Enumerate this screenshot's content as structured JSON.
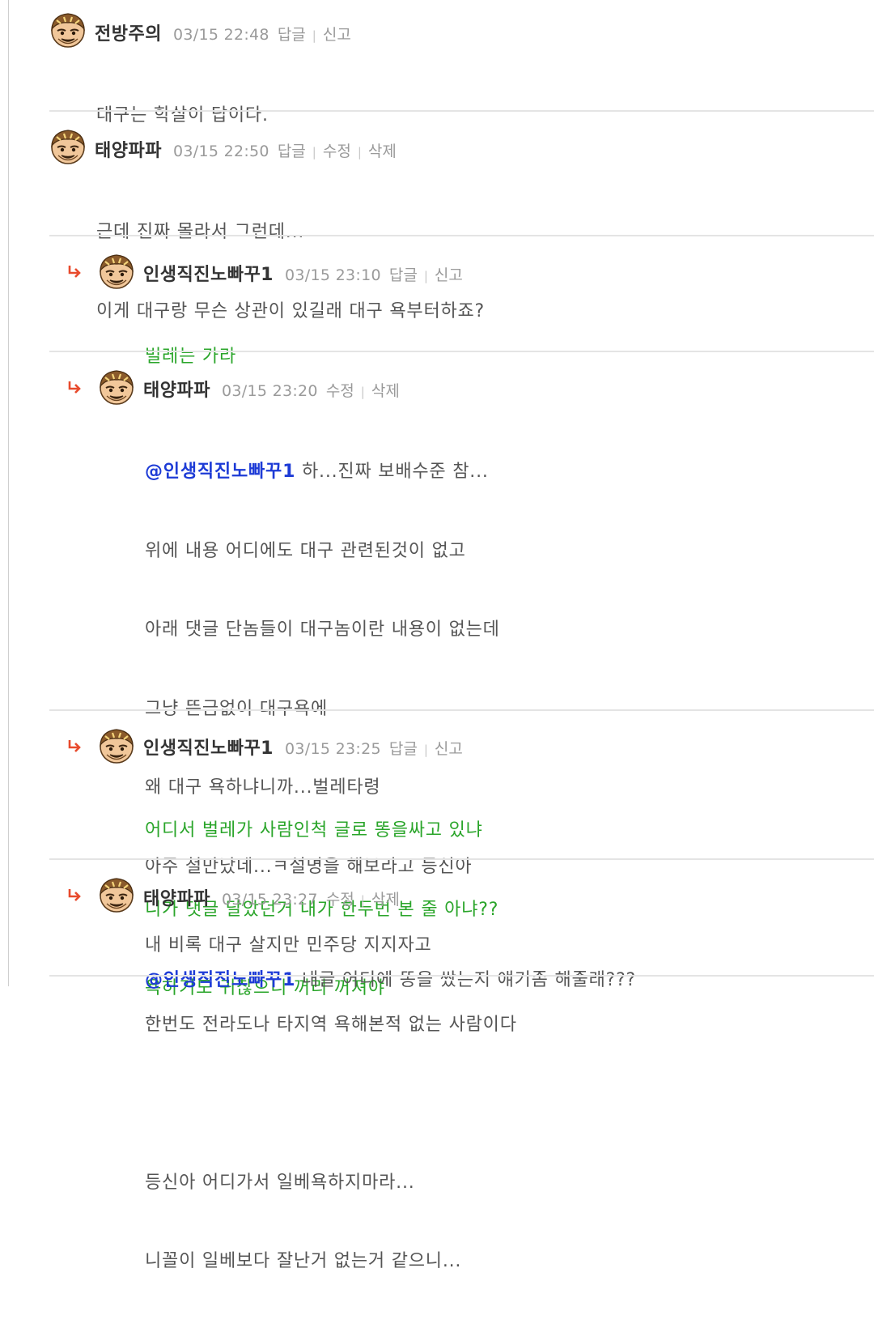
{
  "colors": {
    "reply_green": "#2aa52a",
    "mention_blue": "#1d3bd6",
    "meta_gray": "#9a9a9a",
    "reply_arrow": "#e84a2c"
  },
  "comments": [
    {
      "nickname": "전방주의",
      "date": "03/15 22:48",
      "actions": [
        "답글",
        "신고"
      ],
      "lines": [
        "대구는 학살이 답이다."
      ]
    },
    {
      "nickname": "태양파파",
      "date": "03/15 22:50",
      "actions": [
        "답글",
        "수정",
        "삭제"
      ],
      "lines": [
        "근데 진짜 몰라서 그런데...",
        "이게 대구랑 무슨 상관이 있길래 대구 욕부터하죠?"
      ]
    },
    {
      "nickname": "인생직진노빠꾸1",
      "date": "03/15 23:10",
      "actions": [
        "답글",
        "신고"
      ],
      "lines": [
        "벌레는 가라"
      ]
    },
    {
      "nickname": "태양파파",
      "date": "03/15 23:20",
      "actions": [
        "수정",
        "삭제"
      ],
      "mention": "@인생직진노빠꾸1",
      "first_line_rest": " 하...진짜 보배수준 참...",
      "lines": [
        "위에 내용 어디에도 대구 관련된것이 없고",
        "아래 댓글 단놈들이 대구놈이란 내용이 없는데",
        "그냥 뜬금없이 대구욕에",
        "왜 대구 욕하냐니까...벌레타령",
        "아주 철만났네...ㅋ설명을 해보라고 등신아",
        "내 비록 대구 살지만 민주당 지지자고",
        "한번도 전라도나 타지역 욕해본적 없는 사람이다",
        "",
        "등신아 어디가서 일베욕하지마라...",
        "니꼴이 일베보다 잘난거 없는거 같으니..."
      ]
    },
    {
      "nickname": "인생직진노빠꾸1",
      "date": "03/15 23:25",
      "actions": [
        "답글",
        "신고"
      ],
      "lines": [
        "어디서 벌레가 사람인척 글로 똥을싸고 있냐",
        "니가 댓글 달았던거 내가 한두번 본 줄 아냐??",
        "욕하기도 귀찮으니 꺼리 꺼져야"
      ]
    },
    {
      "nickname": "태양파파",
      "date": "03/15 23:27",
      "actions": [
        "수정",
        "삭제"
      ],
      "mention": "@인생직진노빠꾸1",
      "first_line_rest": " 내글 어디에 똥을 쌌는지 얘기좀 해줄래???",
      "lines": []
    }
  ]
}
